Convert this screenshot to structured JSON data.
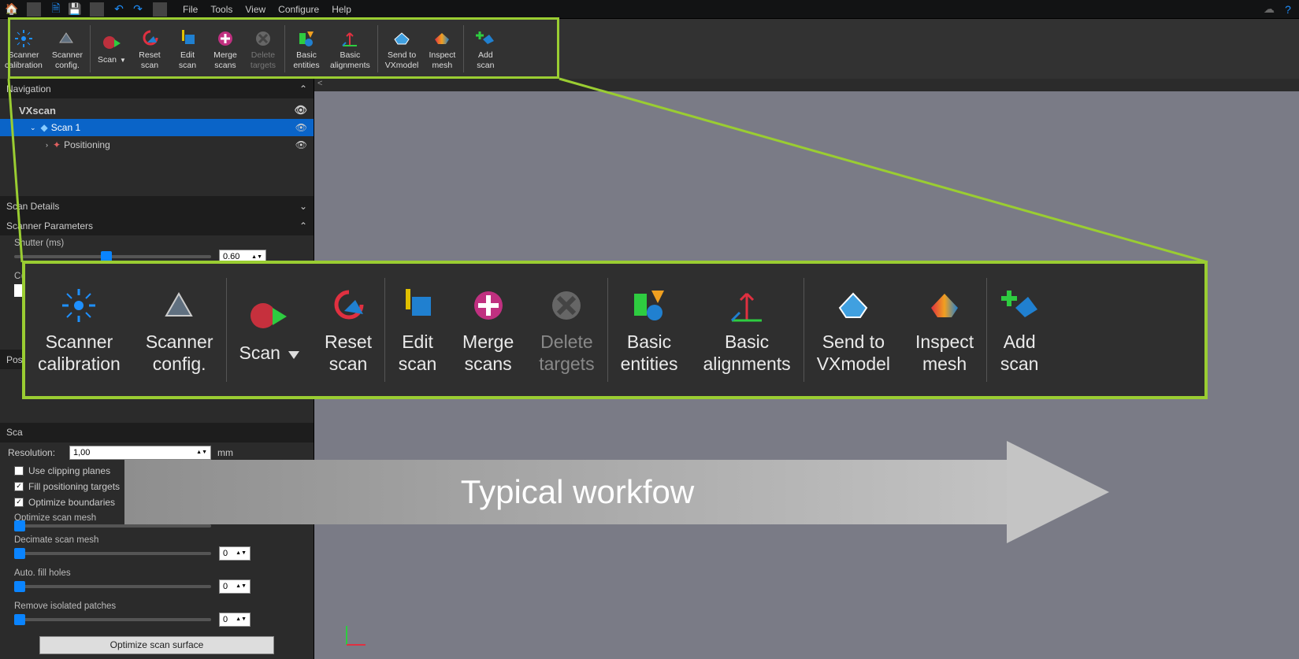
{
  "menubar": {
    "items": [
      "File",
      "Tools",
      "View",
      "Configure",
      "Help"
    ]
  },
  "ribbon": [
    {
      "label": "Scanner\ncalibration"
    },
    {
      "label": "Scanner\nconfig."
    },
    {
      "label": "Scan",
      "dropdown": true
    },
    {
      "label": "Reset\nscan"
    },
    {
      "label": "Edit\nscan"
    },
    {
      "label": "Merge\nscans"
    },
    {
      "label": "Delete\ntargets",
      "disabled": true
    },
    {
      "label": "Basic\nentities"
    },
    {
      "label": "Basic\nalignments"
    },
    {
      "label": "Send to\nVXmodel"
    },
    {
      "label": "Inspect\nmesh"
    },
    {
      "label": "Add\nscan"
    }
  ],
  "nav": {
    "title": "Navigation",
    "root": "VXscan",
    "scan": "Scan 1",
    "positioning": "Positioning"
  },
  "panels": {
    "scanDetails": "Scan Details",
    "scannerParams": "Scanner Parameters",
    "positioningParams": "Positioning Parameters",
    "scanParams": "Scan Parameters"
  },
  "scannerParams": {
    "shutterLabel": "Shutter (ms)",
    "shutterValue": "0.60",
    "complexLabel": "Complex"
  },
  "scanParams": {
    "resolutionLabel": "Resolution:",
    "resolutionValue": "1,00",
    "resolutionUnit": "mm",
    "useClipping": "Use clipping planes",
    "fillTargets": "Fill positioning targets",
    "optimizeBounds": "Optimize boundaries",
    "optimizeMesh": "Optimize scan mesh",
    "decimateMesh": "Decimate scan mesh",
    "decimateVal": "0",
    "autoFill": "Auto. fill holes",
    "autoFillVal": "0",
    "removeIso": "Remove isolated patches",
    "removeIsoVal": "0",
    "optimizeBtn": "Optimize scan surface"
  },
  "callout": [
    {
      "label": "Scanner\ncalibration"
    },
    {
      "label": "Scanner\nconfig."
    },
    {
      "label": "Scan",
      "dropdown": true
    },
    {
      "label": "Reset\nscan"
    },
    {
      "label": "Edit\nscan"
    },
    {
      "label": "Merge\nscans"
    },
    {
      "label": "Delete\ntargets",
      "disabled": true
    },
    {
      "label": "Basic\nentities"
    },
    {
      "label": "Basic\nalignments"
    },
    {
      "label": "Send to\nVXmodel"
    },
    {
      "label": "Inspect\nmesh"
    },
    {
      "label": "Add\nscan"
    }
  ],
  "workflow": "Typical workfow"
}
